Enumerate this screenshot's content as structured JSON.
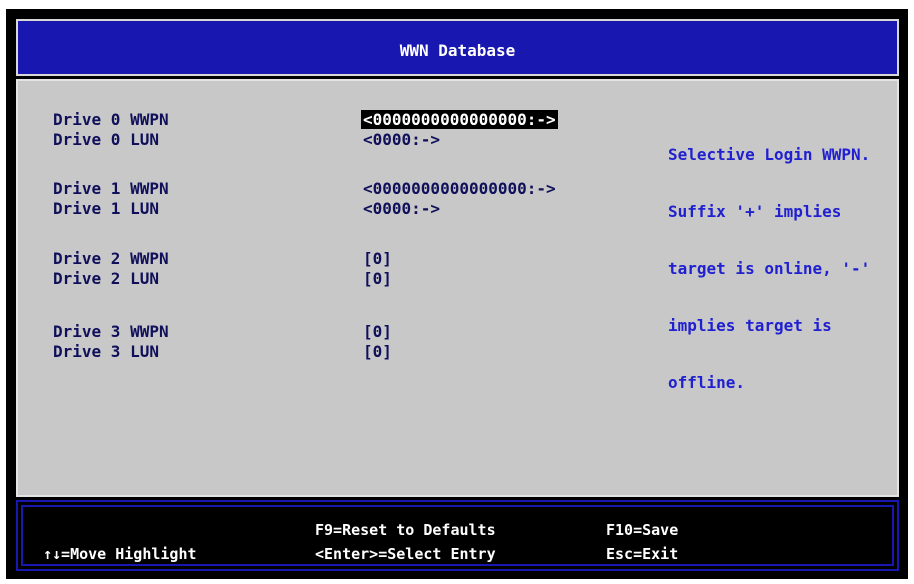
{
  "header": {
    "title": "WWN Database"
  },
  "drives": [
    {
      "wwpn_label": "Drive 0 WWPN",
      "wwpn_value": "<0000000000000000:->",
      "lun_label": "Drive 0 LUN",
      "lun_value": "<0000:->"
    },
    {
      "wwpn_label": "Drive 1 WWPN",
      "wwpn_value": "<0000000000000000:->",
      "lun_label": "Drive 1 LUN",
      "lun_value": "<0000:->"
    },
    {
      "wwpn_label": "Drive 2 WWPN",
      "wwpn_value": "[0]",
      "lun_label": "Drive 2 LUN",
      "lun_value": "[0]"
    },
    {
      "wwpn_label": "Drive 3 WWPN",
      "wwpn_value": "[0]",
      "lun_label": "Drive 3 LUN",
      "lun_value": "[0]"
    }
  ],
  "help": {
    "lines": [
      "Selective Login WWPN.",
      "Suffix '+' implies",
      "target is online, '-'",
      "implies target is",
      "offline."
    ]
  },
  "footer": {
    "move_highlight": "↑↓=Move Highlight",
    "reset_defaults": "F9=Reset to Defaults",
    "select_entry": "<Enter>=Select Entry",
    "save": "F10=Save",
    "exit": "Esc=Exit"
  },
  "colors": {
    "header_bg": "#1818b0",
    "content_bg": "#c8c8c8",
    "label_text": "#10105a",
    "help_text": "#2020d0",
    "selected_bg": "#000000"
  }
}
